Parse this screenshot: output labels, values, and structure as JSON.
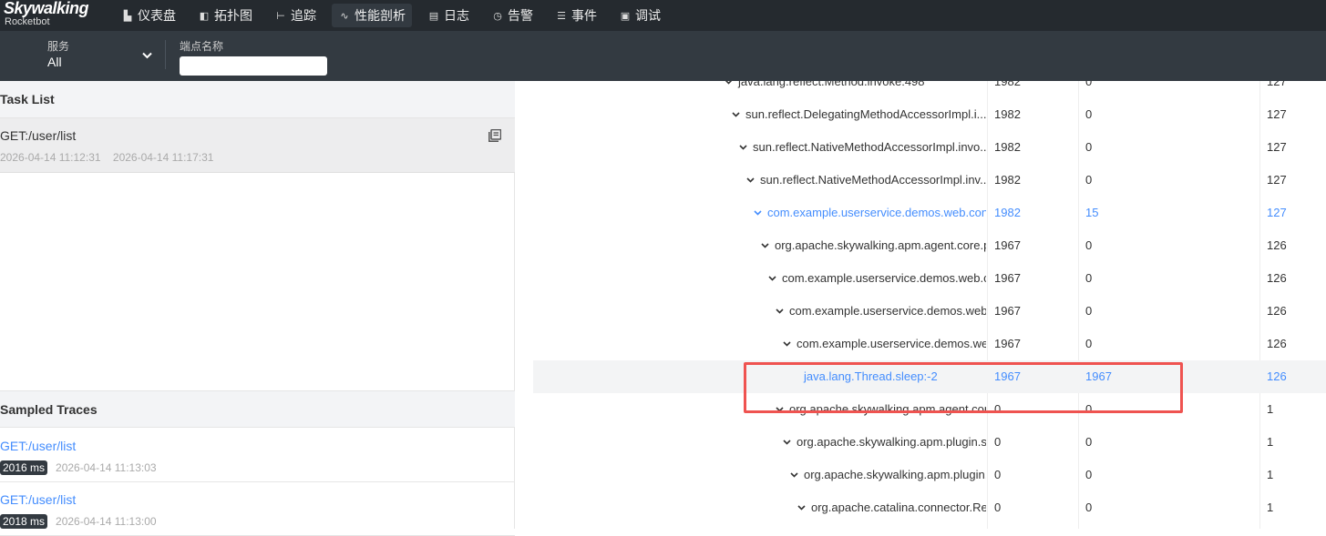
{
  "logo": {
    "brand": "Skywalking",
    "sub": "Rocketbot"
  },
  "nav": [
    {
      "label": "仪表盘",
      "icon": "dashboard-icon",
      "glyph": "▙"
    },
    {
      "label": "拓扑图",
      "icon": "topology-icon",
      "glyph": "◧"
    },
    {
      "label": "追踪",
      "icon": "trace-icon",
      "glyph": "⊢"
    },
    {
      "label": "性能剖析",
      "icon": "profile-icon",
      "glyph": "∿"
    },
    {
      "label": "日志",
      "icon": "log-icon",
      "glyph": "▤"
    },
    {
      "label": "告警",
      "icon": "alarm-icon",
      "glyph": "◷"
    },
    {
      "label": "事件",
      "icon": "event-icon",
      "glyph": "☰"
    },
    {
      "label": "调试",
      "icon": "debug-icon",
      "glyph": "▣"
    }
  ],
  "filter": {
    "service_label": "服务",
    "service_value": "All",
    "endpoint_label": "端点名称",
    "endpoint_value": ""
  },
  "task_list": {
    "title": "Task List",
    "items": [
      {
        "name": "GET:/user/list",
        "start": "2026-04-14 11:12:31",
        "end": "2026-04-14 11:17:31"
      }
    ]
  },
  "sampled_traces": {
    "title": "Sampled Traces",
    "items": [
      {
        "name": "GET:/user/list",
        "duration": "2016 ms",
        "time": "2026-04-14 11:13:03"
      },
      {
        "name": "GET:/user/list",
        "duration": "2018 ms",
        "time": "2026-04-14 11:13:00"
      }
    ]
  },
  "tree_rows": [
    {
      "name": "java.lang.reflect.Method.invoke:498",
      "c1": "1982",
      "c2": "0",
      "c3": "127",
      "depth": 0,
      "chevron": true,
      "style": "clip"
    },
    {
      "name": "sun.reflect.DelegatingMethodAccessorImpl.i...",
      "c1": "1982",
      "c2": "0",
      "c3": "127",
      "depth": 1,
      "chevron": true,
      "style": "normal"
    },
    {
      "name": "sun.reflect.NativeMethodAccessorImpl.invo...",
      "c1": "1982",
      "c2": "0",
      "c3": "127",
      "depth": 2,
      "chevron": true,
      "style": "normal"
    },
    {
      "name": "sun.reflect.NativeMethodAccessorImpl.inv...",
      "c1": "1982",
      "c2": "0",
      "c3": "127",
      "depth": 3,
      "chevron": true,
      "style": "normal"
    },
    {
      "name": "com.example.userservice.demos.web.cont...",
      "c1": "1982",
      "c2": "15",
      "c3": "127",
      "depth": 4,
      "chevron": true,
      "style": "blue"
    },
    {
      "name": "org.apache.skywalking.apm.agent.core.pl...",
      "c1": "1967",
      "c2": "0",
      "c3": "126",
      "depth": 5,
      "chevron": true,
      "style": "normal"
    },
    {
      "name": "com.example.userservice.demos.web.co...",
      "c1": "1967",
      "c2": "0",
      "c3": "126",
      "depth": 6,
      "chevron": true,
      "style": "normal"
    },
    {
      "name": "com.example.userservice.demos.web.c...",
      "c1": "1967",
      "c2": "0",
      "c3": "126",
      "depth": 7,
      "chevron": true,
      "style": "normal"
    },
    {
      "name": "com.example.userservice.demos.web....",
      "c1": "1967",
      "c2": "0",
      "c3": "126",
      "depth": 8,
      "chevron": true,
      "style": "normal"
    },
    {
      "name": "java.lang.Thread.sleep:-2",
      "c1": "1967",
      "c2": "1967",
      "c3": "126",
      "depth": 9,
      "chevron": false,
      "style": "blue-hl"
    },
    {
      "name": "org.apache.skywalking.apm.agent.core.pl...",
      "c1": "0",
      "c2": "0",
      "c3": "1",
      "depth": 7,
      "chevron": true,
      "style": "normal"
    },
    {
      "name": "org.apache.skywalking.apm.plugin.sprin...",
      "c1": "0",
      "c2": "0",
      "c3": "1",
      "depth": 8,
      "chevron": true,
      "style": "normal"
    },
    {
      "name": "org.apache.skywalking.apm.plugin.spri...",
      "c1": "0",
      "c2": "0",
      "c3": "1",
      "depth": 9,
      "chevron": true,
      "style": "normal"
    },
    {
      "name": "org.apache.catalina.connector.Reque...",
      "c1": "0",
      "c2": "0",
      "c3": "1",
      "depth": 10,
      "chevron": true,
      "style": "normal"
    }
  ],
  "colors": {
    "accent": "#448dfe",
    "nav_bg": "#252a2f",
    "filter_bg": "#333a41",
    "highlight_box": "#ef5350"
  }
}
